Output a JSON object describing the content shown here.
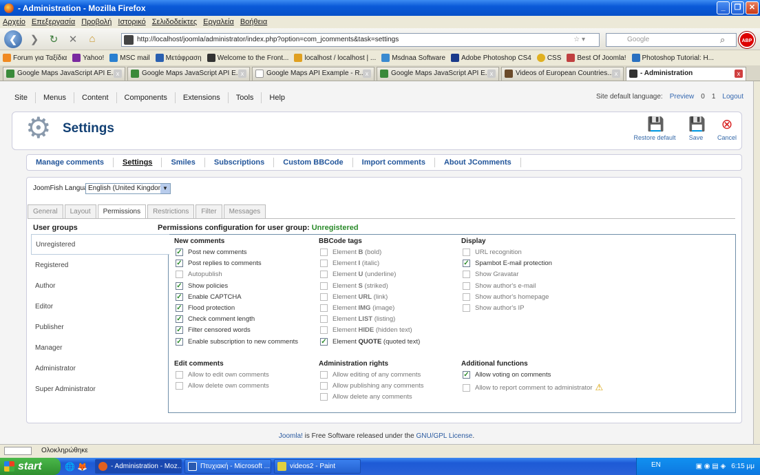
{
  "window": {
    "title": "- Administration - Mozilla Firefox"
  },
  "menubar": [
    "Αρχείο",
    "Επεξεργασία",
    "Προβολή",
    "Ιστορικό",
    "Σελιδοδείκτες",
    "Εργαλεία",
    "Βοήθεια"
  ],
  "navbar": {
    "url": "http://localhost/joomla/administrator/index.php?option=com_jcomments&task=settings",
    "search_placeholder": "Google",
    "abp": "ABP"
  },
  "bookmarks": [
    "Forum για Ταξίδια",
    "Yahoo!",
    "MSC mail",
    "Μετάφραση",
    "Welcome to the Front...",
    "localhost / localhost | ...",
    "Msdnaa Software",
    "Adobe Photoshop CS4",
    "CSS",
    "Best Of Joomla!",
    "Photoshop Tutorial: H..."
  ],
  "tabs": [
    "Google Maps JavaScript API E...",
    "Google Maps JavaScript API E...",
    "Google Maps API Example - R...",
    "Google Maps JavaScript API E...",
    "Videos of European Countries...",
    "- Administration"
  ],
  "joomla_menu": [
    "Site",
    "Menus",
    "Content",
    "Components",
    "Extensions",
    "Tools",
    "Help"
  ],
  "joomla_status": {
    "language_label": "Site default language:",
    "preview": "Preview",
    "messages": "0",
    "users": "1",
    "logout": "Logout"
  },
  "header": {
    "title": "Settings",
    "restore": "Restore default",
    "save": "Save",
    "cancel": "Cancel"
  },
  "submenu": [
    "Manage comments",
    "Settings",
    "Smiles",
    "Subscriptions",
    "Custom BBCode",
    "Import comments",
    "About JComments"
  ],
  "joomfish": {
    "label": "JoomFish Language:",
    "value": "English (United Kingdom)"
  },
  "ptabs": [
    "General",
    "Layout",
    "Permissions",
    "Restrictions",
    "Filter",
    "Messages"
  ],
  "user_groups": {
    "title": "User groups",
    "items": [
      "Unregistered",
      "Registered",
      "Author",
      "Editor",
      "Publisher",
      "Manager",
      "Administrator",
      "Super Administrator"
    ]
  },
  "perm_title": {
    "prefix": "Permissions configuration for user group:",
    "group": "Unregistered"
  },
  "sections": {
    "new_comments": {
      "title": "New comments",
      "items": [
        {
          "label": "Post new comments",
          "checked": true
        },
        {
          "label": "Post replies to comments",
          "checked": true
        },
        {
          "label": "Autopublish",
          "checked": false
        },
        {
          "label": "Show policies",
          "checked": true
        },
        {
          "label": "Enable CAPTCHA",
          "checked": true
        },
        {
          "label": "Flood protection",
          "checked": true
        },
        {
          "label": "Check comment length",
          "checked": true
        },
        {
          "label": "Filter censored words",
          "checked": true
        },
        {
          "label": "Enable subscription to new comments",
          "checked": true
        }
      ]
    },
    "bbcode": {
      "title": "BBCode tags",
      "items": [
        {
          "pre": "Element ",
          "bold": "B",
          "post": " (bold)",
          "checked": false
        },
        {
          "pre": "Element ",
          "bold": "I",
          "post": " (italic)",
          "checked": false
        },
        {
          "pre": "Element ",
          "bold": "U",
          "post": " (underline)",
          "checked": false
        },
        {
          "pre": "Element ",
          "bold": "S",
          "post": " (striked)",
          "checked": false
        },
        {
          "pre": "Element ",
          "bold": "URL",
          "post": " (link)",
          "checked": false
        },
        {
          "pre": "Element ",
          "bold": "IMG",
          "post": " (image)",
          "checked": false
        },
        {
          "pre": "Element ",
          "bold": "LIST",
          "post": " (listing)",
          "checked": false
        },
        {
          "pre": "Element ",
          "bold": "HIDE",
          "post": " (hidden text)",
          "checked": false
        },
        {
          "pre": "Element ",
          "bold": "QUOTE",
          "post": " (quoted text)",
          "checked": true
        }
      ]
    },
    "display": {
      "title": "Display",
      "items": [
        {
          "label": "URL recognition",
          "checked": false
        },
        {
          "label": "Spambot E-mail protection",
          "checked": true
        },
        {
          "label": "Show Gravatar",
          "checked": false
        },
        {
          "label": "Show author's e-mail",
          "checked": false
        },
        {
          "label": "Show author's homepage",
          "checked": false
        },
        {
          "label": "Show author's IP",
          "checked": false
        }
      ]
    },
    "edit_comments": {
      "title": "Edit comments",
      "items": [
        {
          "label": "Allow to edit own comments",
          "checked": false
        },
        {
          "label": "Allow delete own comments",
          "checked": false
        }
      ]
    },
    "admin_rights": {
      "title": "Administration rights",
      "items": [
        {
          "label": "Allow editing of any comments",
          "checked": false
        },
        {
          "label": "Allow publishing any comments",
          "checked": false
        },
        {
          "label": "Allow delete any comments",
          "checked": false
        }
      ]
    },
    "additional": {
      "title": "Additional functions",
      "items": [
        {
          "label": "Allow voting on comments",
          "checked": true
        },
        {
          "label": "Allow to report comment to administrator",
          "checked": false
        }
      ]
    }
  },
  "footer": {
    "joomla": "Joomla!",
    "middle": " is Free Software released under the ",
    "license": "GNU/GPL License",
    "end": "."
  },
  "statusbar": {
    "text": "Ολοκληρώθηκε"
  },
  "taskbar": {
    "start": "start",
    "items": [
      "- Administration - Moz...",
      "Πτυχιακή - Microsoft ...",
      "videos2 - Paint"
    ],
    "lang": "EN",
    "clock": "6:15 μμ"
  }
}
